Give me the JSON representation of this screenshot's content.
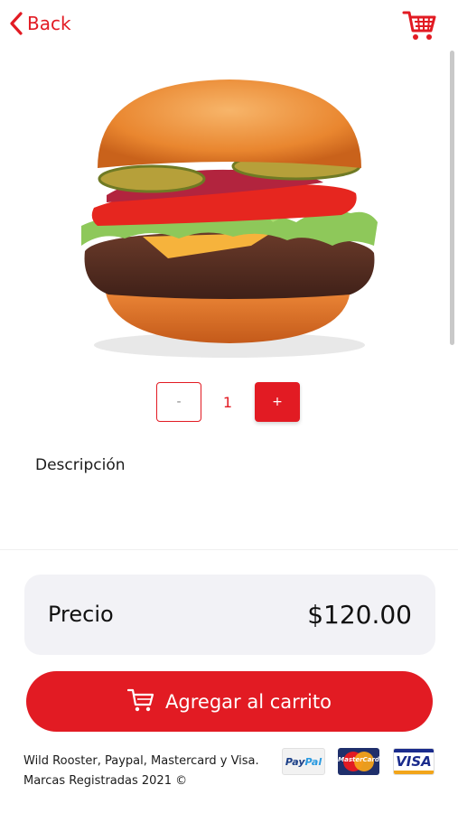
{
  "header": {
    "back_label": "Back",
    "icons": {
      "back": "chevron-left-icon",
      "cart": "shopping-cart-icon"
    }
  },
  "product": {
    "image": "hamburger-image",
    "quantity": {
      "minus_label": "-",
      "value": "1",
      "plus_label": "+"
    },
    "description_title": "Descripción"
  },
  "price": {
    "label": "Precio",
    "value": "$120.00"
  },
  "add_to_cart": {
    "label": "Agregar al carrito",
    "icon": "shopping-cart-icon"
  },
  "footer": {
    "line1": "Wild Rooster, Paypal, Mastercard y Visa.",
    "line2": "Marcas Registradas 2021 ©",
    "payment_logos": {
      "paypal_a": "Pay",
      "paypal_b": "Pal",
      "mastercard": "MasterCard",
      "visa": "VISA"
    }
  },
  "colors": {
    "accent": "#e21b23",
    "price_box_bg": "#f2f2f6",
    "text": "#1b1b1b"
  }
}
